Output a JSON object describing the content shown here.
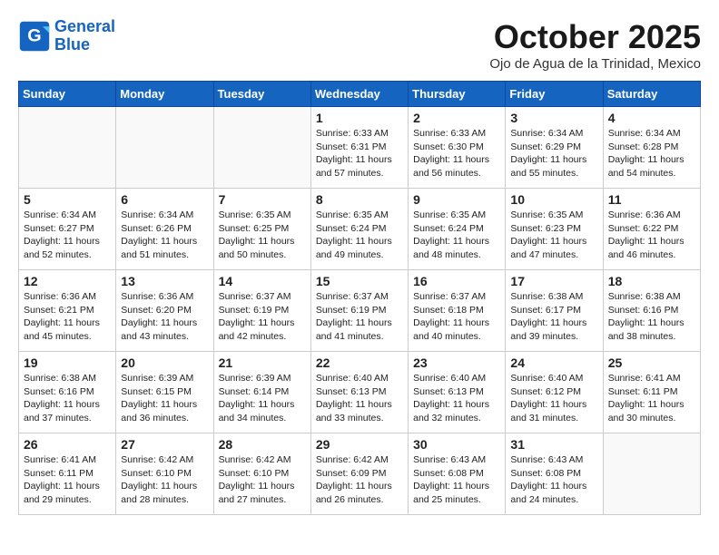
{
  "logo": {
    "line1": "General",
    "line2": "Blue"
  },
  "title": "October 2025",
  "location": "Ojo de Agua de la Trinidad, Mexico",
  "days_of_week": [
    "Sunday",
    "Monday",
    "Tuesday",
    "Wednesday",
    "Thursday",
    "Friday",
    "Saturday"
  ],
  "weeks": [
    [
      {
        "day": "",
        "empty": true
      },
      {
        "day": "",
        "empty": true
      },
      {
        "day": "",
        "empty": true
      },
      {
        "day": "1",
        "sunrise": "6:33 AM",
        "sunset": "6:31 PM",
        "daylight": "11 hours and 57 minutes."
      },
      {
        "day": "2",
        "sunrise": "6:33 AM",
        "sunset": "6:30 PM",
        "daylight": "11 hours and 56 minutes."
      },
      {
        "day": "3",
        "sunrise": "6:34 AM",
        "sunset": "6:29 PM",
        "daylight": "11 hours and 55 minutes."
      },
      {
        "day": "4",
        "sunrise": "6:34 AM",
        "sunset": "6:28 PM",
        "daylight": "11 hours and 54 minutes."
      }
    ],
    [
      {
        "day": "5",
        "sunrise": "6:34 AM",
        "sunset": "6:27 PM",
        "daylight": "11 hours and 52 minutes."
      },
      {
        "day": "6",
        "sunrise": "6:34 AM",
        "sunset": "6:26 PM",
        "daylight": "11 hours and 51 minutes."
      },
      {
        "day": "7",
        "sunrise": "6:35 AM",
        "sunset": "6:25 PM",
        "daylight": "11 hours and 50 minutes."
      },
      {
        "day": "8",
        "sunrise": "6:35 AM",
        "sunset": "6:24 PM",
        "daylight": "11 hours and 49 minutes."
      },
      {
        "day": "9",
        "sunrise": "6:35 AM",
        "sunset": "6:24 PM",
        "daylight": "11 hours and 48 minutes."
      },
      {
        "day": "10",
        "sunrise": "6:35 AM",
        "sunset": "6:23 PM",
        "daylight": "11 hours and 47 minutes."
      },
      {
        "day": "11",
        "sunrise": "6:36 AM",
        "sunset": "6:22 PM",
        "daylight": "11 hours and 46 minutes."
      }
    ],
    [
      {
        "day": "12",
        "sunrise": "6:36 AM",
        "sunset": "6:21 PM",
        "daylight": "11 hours and 45 minutes."
      },
      {
        "day": "13",
        "sunrise": "6:36 AM",
        "sunset": "6:20 PM",
        "daylight": "11 hours and 43 minutes."
      },
      {
        "day": "14",
        "sunrise": "6:37 AM",
        "sunset": "6:19 PM",
        "daylight": "11 hours and 42 minutes."
      },
      {
        "day": "15",
        "sunrise": "6:37 AM",
        "sunset": "6:19 PM",
        "daylight": "11 hours and 41 minutes."
      },
      {
        "day": "16",
        "sunrise": "6:37 AM",
        "sunset": "6:18 PM",
        "daylight": "11 hours and 40 minutes."
      },
      {
        "day": "17",
        "sunrise": "6:38 AM",
        "sunset": "6:17 PM",
        "daylight": "11 hours and 39 minutes."
      },
      {
        "day": "18",
        "sunrise": "6:38 AM",
        "sunset": "6:16 PM",
        "daylight": "11 hours and 38 minutes."
      }
    ],
    [
      {
        "day": "19",
        "sunrise": "6:38 AM",
        "sunset": "6:16 PM",
        "daylight": "11 hours and 37 minutes."
      },
      {
        "day": "20",
        "sunrise": "6:39 AM",
        "sunset": "6:15 PM",
        "daylight": "11 hours and 36 minutes."
      },
      {
        "day": "21",
        "sunrise": "6:39 AM",
        "sunset": "6:14 PM",
        "daylight": "11 hours and 34 minutes."
      },
      {
        "day": "22",
        "sunrise": "6:40 AM",
        "sunset": "6:13 PM",
        "daylight": "11 hours and 33 minutes."
      },
      {
        "day": "23",
        "sunrise": "6:40 AM",
        "sunset": "6:13 PM",
        "daylight": "11 hours and 32 minutes."
      },
      {
        "day": "24",
        "sunrise": "6:40 AM",
        "sunset": "6:12 PM",
        "daylight": "11 hours and 31 minutes."
      },
      {
        "day": "25",
        "sunrise": "6:41 AM",
        "sunset": "6:11 PM",
        "daylight": "11 hours and 30 minutes."
      }
    ],
    [
      {
        "day": "26",
        "sunrise": "6:41 AM",
        "sunset": "6:11 PM",
        "daylight": "11 hours and 29 minutes."
      },
      {
        "day": "27",
        "sunrise": "6:42 AM",
        "sunset": "6:10 PM",
        "daylight": "11 hours and 28 minutes."
      },
      {
        "day": "28",
        "sunrise": "6:42 AM",
        "sunset": "6:10 PM",
        "daylight": "11 hours and 27 minutes."
      },
      {
        "day": "29",
        "sunrise": "6:42 AM",
        "sunset": "6:09 PM",
        "daylight": "11 hours and 26 minutes."
      },
      {
        "day": "30",
        "sunrise": "6:43 AM",
        "sunset": "6:08 PM",
        "daylight": "11 hours and 25 minutes."
      },
      {
        "day": "31",
        "sunrise": "6:43 AM",
        "sunset": "6:08 PM",
        "daylight": "11 hours and 24 minutes."
      },
      {
        "day": "",
        "empty": true
      }
    ]
  ]
}
